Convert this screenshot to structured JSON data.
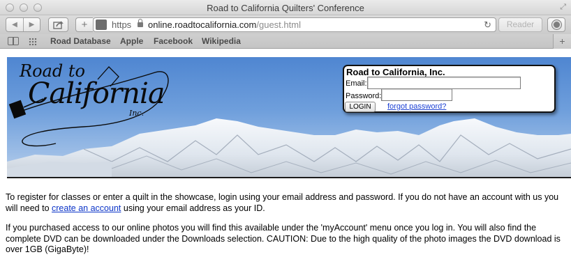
{
  "window": {
    "title": "Road to California Quilters' Conference"
  },
  "toolbar": {
    "back_icon": "back-arrow-icon",
    "forward_icon": "forward-arrow-icon",
    "share_icon": "share-icon",
    "add_icon": "plus-icon",
    "address": {
      "scheme": "https",
      "host": "online.roadtocalifornia.com",
      "path": "/guest.html"
    },
    "reader_label": "Reader"
  },
  "bookmarks": {
    "items": [
      "Road Database",
      "Apple",
      "Facebook",
      "Wikipedia"
    ],
    "new_tab": "+"
  },
  "banner": {
    "logo": {
      "line1": "Road to",
      "line2": "California",
      "line3": "Inc."
    },
    "login": {
      "title": "Road to California, Inc.",
      "email_label": "Email:",
      "email_value": "",
      "password_label": "Password:",
      "password_value": "",
      "button_label": "LOGIN",
      "forgot_label": "forgot password?"
    }
  },
  "content": {
    "p1_before": "To register for classes or enter a quilt in the showcase, login using your email address and password. If you do not have an account with us you will need to ",
    "p1_link": "create an account",
    "p1_after": " using your email address as your ID.",
    "p2": "If you purchased access to our online photos you will find this available under the 'myAccount' menu once you log in. You will also find the complete DVD can be downloaded under the Downloads selection. CAUTION: Due to the high quality of the photo images the DVD download is over 1GB (GigaByte)!"
  },
  "colors": {
    "link": "#0b34c8",
    "sky_top": "#4f86d1",
    "sky_bottom": "#b9d0ec"
  }
}
